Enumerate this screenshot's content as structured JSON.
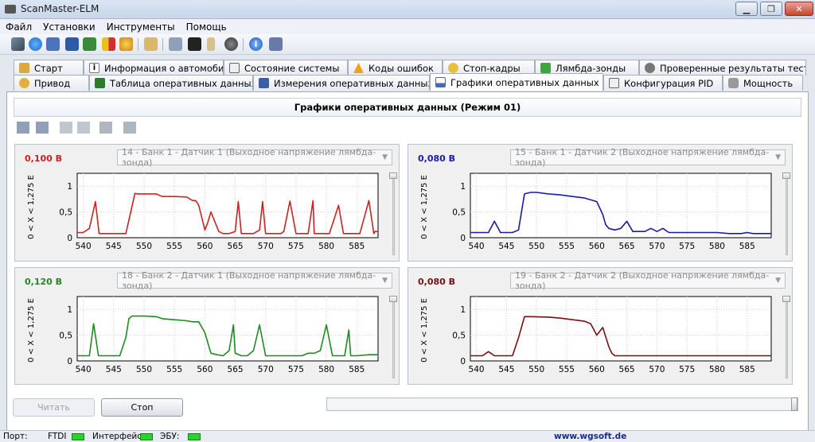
{
  "window": {
    "title": "ScanMaster-ELM"
  },
  "menu": [
    "Файл",
    "Установки",
    "Инструменты",
    "Помощь"
  ],
  "tabs_row1": [
    "Старт",
    "Информация о автомобиле",
    "Состояние системы",
    "Коды ошибок",
    "Стоп-кадры",
    "Лямбда-зонды",
    "Проверенные результаты теста"
  ],
  "tabs_row2": [
    "Привод",
    "Таблица оперативных данных",
    "Измерения оперативных данных",
    "Графики оперативных данных",
    "Конфигурация PID",
    "Мощность"
  ],
  "active_tab": "Графики оперативных данных",
  "panel_title": "Графики оперативных данных (Режим 01)",
  "colors": {
    "red": "#cc2222",
    "blue": "#1a1aaa",
    "green": "#1f8a1f",
    "darkred": "#7a0e0e"
  },
  "graphs": [
    {
      "value": "0,100 В",
      "sensor": "14 - Банк 1 - Датчик 1 (Выходное напряжение лямбда-зонда)",
      "color": "red",
      "yaxis": "0   < X <   1,275 Е"
    },
    {
      "value": "0,080 В",
      "sensor": "15 - Банк 1 - Датчик 2 (Выходное напряжение лямбда-зонда)",
      "color": "blue",
      "yaxis": "0   < X <   1,275 Е"
    },
    {
      "value": "0,120 В",
      "sensor": "18 - Банк 2 - Датчик 1 (Выходное напряжение лямбда-зонда)",
      "color": "green",
      "yaxis": "0   < X <   1,275 Е"
    },
    {
      "value": "0,080 В",
      "sensor": "19 - Банк 2 - Датчик 2 (Выходное напряжение лямбда-зонда)",
      "color": "darkred",
      "yaxis": "0   < X <   1,275 Е"
    }
  ],
  "chart_data": [
    {
      "type": "line",
      "xlim": [
        539,
        588.5
      ],
      "ylim": [
        0,
        1.25
      ],
      "yticks": [
        "0",
        "0,5",
        "1"
      ],
      "xticks": [
        540,
        545,
        550,
        555,
        560,
        565,
        570,
        575,
        580,
        585
      ],
      "x": [
        539,
        540,
        541,
        542,
        542.6,
        544,
        547,
        547.9,
        548.5,
        549,
        552,
        553,
        555,
        557,
        558,
        558.5,
        559,
        560,
        560.5,
        561,
        562.3,
        563,
        564,
        565,
        565.5,
        566,
        567,
        568,
        569,
        569.5,
        570,
        572.5,
        573,
        574,
        575,
        575.5,
        577,
        577.8,
        578,
        579,
        580,
        580.5,
        582,
        582.8,
        583,
        584,
        585,
        585.5,
        587,
        587.8,
        588,
        588.5
      ],
      "y": [
        0.1,
        0.1,
        0.18,
        0.7,
        0.08,
        0.08,
        0.08,
        0.55,
        0.86,
        0.85,
        0.85,
        0.8,
        0.8,
        0.79,
        0.72,
        0.72,
        0.63,
        0.15,
        0.3,
        0.5,
        0.12,
        0.08,
        0.08,
        0.12,
        0.7,
        0.08,
        0.08,
        0.08,
        0.15,
        0.7,
        0.08,
        0.08,
        0.12,
        0.71,
        0.08,
        0.08,
        0.08,
        0.72,
        0.08,
        0.08,
        0.08,
        0.08,
        0.63,
        0.08,
        0.08,
        0.08,
        0.08,
        0.08,
        0.72,
        0.08,
        0.12,
        0.12
      ]
    },
    {
      "type": "line",
      "xlim": [
        539,
        589
      ],
      "ylim": [
        0,
        1.25
      ],
      "yticks": [
        "0",
        "0,5",
        "1"
      ],
      "xticks": [
        540,
        545,
        550,
        555,
        560,
        565,
        570,
        575,
        580,
        585
      ],
      "x": [
        539,
        541,
        542,
        543,
        544,
        545,
        546,
        547,
        548,
        549,
        550,
        552,
        554,
        556,
        558,
        560,
        561,
        561.5,
        562,
        563,
        564,
        565,
        566,
        567,
        568,
        569,
        570,
        571,
        572,
        573,
        575,
        578,
        580,
        582,
        584,
        585,
        586,
        589
      ],
      "y": [
        0.1,
        0.1,
        0.1,
        0.32,
        0.1,
        0.1,
        0.1,
        0.15,
        0.85,
        0.88,
        0.88,
        0.85,
        0.83,
        0.8,
        0.77,
        0.7,
        0.45,
        0.25,
        0.18,
        0.15,
        0.18,
        0.32,
        0.12,
        0.12,
        0.12,
        0.18,
        0.12,
        0.18,
        0.1,
        0.1,
        0.1,
        0.1,
        0.1,
        0.08,
        0.08,
        0.1,
        0.08,
        0.08
      ]
    },
    {
      "type": "line",
      "xlim": [
        539,
        588.5
      ],
      "ylim": [
        0,
        1.25
      ],
      "yticks": [
        "0",
        "0,5",
        "1"
      ],
      "xticks": [
        540,
        545,
        550,
        555,
        560,
        565,
        570,
        575,
        580,
        585
      ],
      "x": [
        539,
        541,
        541.7,
        542.5,
        544,
        546,
        547,
        547.5,
        548,
        550,
        552,
        553,
        555,
        557,
        558,
        559,
        560,
        561,
        562,
        563,
        564,
        564.7,
        565,
        566,
        567,
        568,
        569,
        570,
        572,
        574,
        576,
        577,
        578,
        579,
        580,
        581,
        582,
        583,
        583.7,
        584,
        585,
        587,
        588.5
      ],
      "y": [
        0.1,
        0.1,
        0.72,
        0.1,
        0.1,
        0.1,
        0.45,
        0.82,
        0.87,
        0.87,
        0.86,
        0.82,
        0.8,
        0.78,
        0.76,
        0.76,
        0.55,
        0.15,
        0.12,
        0.1,
        0.2,
        0.7,
        0.15,
        0.1,
        0.1,
        0.2,
        0.7,
        0.1,
        0.1,
        0.1,
        0.1,
        0.15,
        0.15,
        0.2,
        0.7,
        0.1,
        0.1,
        0.1,
        0.6,
        0.1,
        0.1,
        0.12,
        0.12
      ]
    },
    {
      "type": "line",
      "xlim": [
        539,
        589
      ],
      "ylim": [
        0,
        1.25
      ],
      "yticks": [
        "0",
        "0,5",
        "1"
      ],
      "xticks": [
        540,
        545,
        550,
        555,
        560,
        565,
        570,
        575,
        580,
        585
      ],
      "x": [
        539,
        541,
        542,
        543,
        545,
        546,
        547,
        548,
        549,
        552,
        554,
        556,
        558,
        559,
        560,
        561,
        562,
        562.5,
        563,
        565,
        570,
        575,
        580,
        585,
        589
      ],
      "y": [
        0.1,
        0.1,
        0.18,
        0.1,
        0.1,
        0.1,
        0.45,
        0.86,
        0.86,
        0.85,
        0.83,
        0.8,
        0.77,
        0.72,
        0.5,
        0.65,
        0.28,
        0.15,
        0.1,
        0.1,
        0.1,
        0.1,
        0.1,
        0.1,
        0.1
      ]
    }
  ],
  "buttons": {
    "read": "Читать",
    "stop": "Стоп"
  },
  "status": {
    "port": "Порт:",
    "ftdi": "FTDI",
    "interface": "Интерфейс",
    "ecu": "ЭБУ:",
    "url": "www.wgsoft.de"
  }
}
